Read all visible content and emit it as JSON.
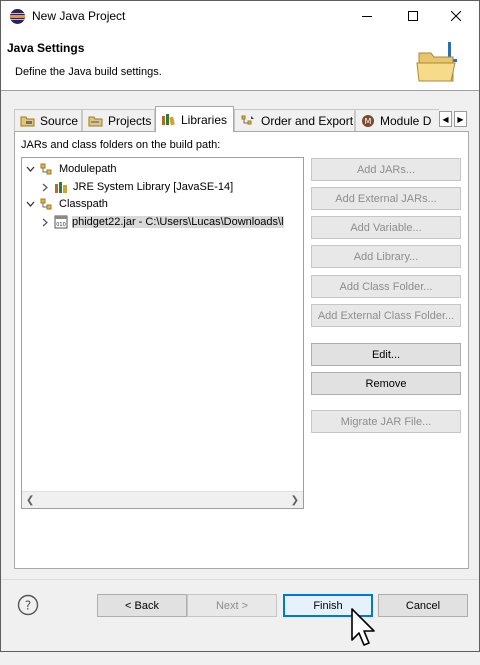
{
  "window": {
    "title": "New Java Project"
  },
  "header": {
    "title": "Java Settings",
    "description": "Define the Java build settings."
  },
  "tabs": [
    {
      "label": "Source",
      "icon": "source-folder-icon"
    },
    {
      "label": "Projects",
      "icon": "projects-icon"
    },
    {
      "label": "Libraries",
      "icon": "libraries-icon",
      "active": true
    },
    {
      "label": "Order and Export",
      "icon": "order-export-icon"
    },
    {
      "label": "Module D",
      "icon": "module-icon"
    }
  ],
  "panel": {
    "label": "JARs and class folders on the build path:",
    "tree": [
      {
        "label": "Modulepath",
        "icon": "modulepath-icon",
        "expanded": true,
        "level": 0
      },
      {
        "label": "JRE System Library [JavaSE-14]",
        "icon": "library-icon",
        "expanded": false,
        "level": 1
      },
      {
        "label": "Classpath",
        "icon": "classpath-icon",
        "expanded": true,
        "level": 0
      },
      {
        "label": "phidget22.jar - C:\\Users\\Lucas\\Downloads\\l",
        "icon": "jar-icon",
        "expanded": false,
        "level": 1,
        "selected": true
      }
    ],
    "buttons": {
      "add_jars": "Add JARs...",
      "add_external_jars": "Add External JARs...",
      "add_variable": "Add Variable...",
      "add_library": "Add Library...",
      "add_class_folder": "Add Class Folder...",
      "add_external_class_folder": "Add External Class Folder...",
      "edit": "Edit...",
      "remove": "Remove",
      "migrate_jar": "Migrate JAR File..."
    }
  },
  "footer": {
    "back": "< Back",
    "next": "Next >",
    "finish": "Finish",
    "cancel": "Cancel"
  }
}
